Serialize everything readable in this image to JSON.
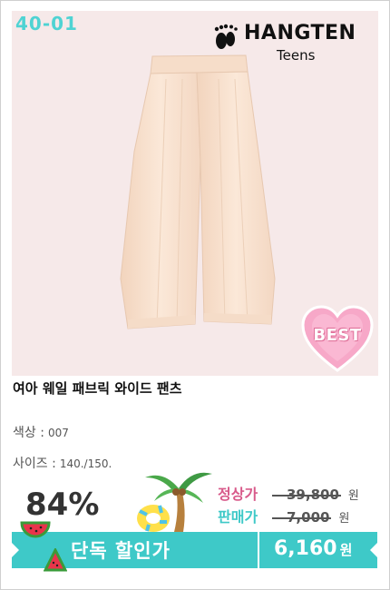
{
  "product": {
    "code": "40-01",
    "brand_name": "HANGTEN",
    "brand_sub": "Teens",
    "badge": "BEST",
    "title": "여아 웨일 패브릭 와이드 팬츠",
    "color_label": "색상 :",
    "color_value": "007",
    "size_label": "사이즈 :",
    "size_value": "140./150."
  },
  "pricing": {
    "discount_pct": "84%",
    "regular_label": "정상가",
    "regular_price": "39,800",
    "sale_label": "판매가",
    "sale_price": "7,000",
    "currency": "원",
    "promo_label": "단독 할인가",
    "final_price": "6,160",
    "final_currency": "원"
  },
  "colors": {
    "accent": "#3ec9c8",
    "code_color": "#4fd3d3",
    "regular_label_color": "#d85a8a",
    "sale_label_color": "#3ec9c8",
    "badge_pink": "#f7a8c8"
  },
  "icons": {
    "brand": "footprint-icon",
    "badge": "heart-badge-icon",
    "deco1": "palm-tree-icon",
    "deco2": "swim-ring-icon",
    "deco3": "watermelon-icon"
  }
}
